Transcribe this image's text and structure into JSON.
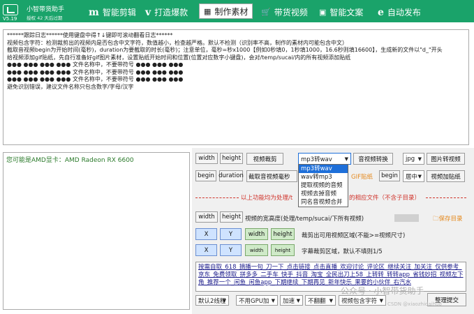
{
  "app": {
    "version": "V5.19",
    "name": "小智带货助手",
    "subtitle": "授权 42 天后过期",
    "brand_color": "#1aa36a"
  },
  "tabs": [
    {
      "icon": "m",
      "icon_name": "m-logo-icon",
      "label": "智能剪辑"
    },
    {
      "icon": "v",
      "icon_name": "v-logo-icon",
      "label": "打造爆款"
    },
    {
      "icon": "▦",
      "icon_name": "grid-icon",
      "label": "制作素材",
      "active": true
    },
    {
      "icon": "🛒",
      "icon_name": "cart-icon",
      "label": "带货视频"
    },
    {
      "icon": "▣",
      "icon_name": "document-icon",
      "label": "智能文案"
    },
    {
      "icon": "e",
      "icon_name": "e-logo-icon",
      "label": "自动发布"
    }
  ],
  "log_lines": [
    "******跟踪日志******使用键盘中得↑↓键即可滚动翻看日志******",
    "视频包含字符：检测裁剪出的视频内是否包含中文字符，数值越小，检查越严格。默认不检测（识别率不高，制作的素材内可能包含中文）",
    "截取音视频begin为开始时间(毫秒)，duration为要截取的时长(毫秒)；注意单位，毫秒=秒x1000【例如0秒填0，1秒填1000，16.6秒则填16600】，生成新的文件以\"d_\"开头",
    "给视频添加gif贴纸，先自行准备好gif图片素材，设置贴纸开始时间和位置(位置对应数字小键盘)，会对/temp/sucai/内的所有视频添加贴纸",
    "●●● ●●● ●●● ●●● 文件名称中，不要带符号 ●●● ●●● ●●●",
    "●●● ●●● ●●● ●●● 文件名称中，不要带符号 ●●● ●●● ●●●",
    "●●● ●●● ●●● ●●● 文件名称中，不要带符号 ●●● ●●● ●●●",
    "避免识别错误，建议文件名称只包含数字/字母/汉字"
  ],
  "gpu_text": "您可能是AMD显卡：AMD Radeon RX 6600",
  "row1": {
    "width_label": "width",
    "height_label": "height",
    "crop_button": "视频裁剪",
    "format_select": "mp3转wav",
    "convert_button": "音视频转换",
    "image_format_select": "jpg",
    "image_to_video_button": "图片转视频"
  },
  "dropdown_options": [
    "mp3转wav",
    "wav转mp3",
    "提取视频的音频",
    "视频去掉音频",
    "同名音视频合并"
  ],
  "row2": {
    "begin_label": "begin",
    "duration_label": "duration",
    "cut_button": "截取音视频毫秒",
    "gif_label": "GIF贴纸",
    "begin2_label": "begin",
    "position_select": "居中",
    "sticker_button": "视频加贴纸"
  },
  "notice": {
    "left": "以上功能均为处理/t",
    "right": "的相应文件（不含子目录）"
  },
  "row3": {
    "width_label": "width",
    "height_label": "height",
    "desc": "视频的宽高度(处理/temp/sucai/下所有视频)",
    "save_link": "保存目录"
  },
  "row4": {
    "x_label": "X",
    "y_label": "Y",
    "width_label": "width",
    "height_label": "height",
    "desc": "裁剪出可用视频区域(不能>=视频尺寸)"
  },
  "row5": {
    "x_label": "X",
    "y_label": "Y",
    "width_label": "width",
    "height_label": "height",
    "desc": "字幕裁剪区域，默认不填则1/5"
  },
  "keywords_text": "按需自取_618_摘播一句_刀一下_点击链接_点击直播_欢迎讨论_评论区_继续关注_加关注_仅供参考_京东_免费领取_拼多多_二手车_快手_抖音_淘宝_全民出刀上58_上转转_转转app_省钱妙招_视频左下角_推荐一个_闲鱼_闲鱼app_下期继续_下期再见_新年快乐_果要的小伙伴_右汽水",
  "bottom": {
    "threads_select": "默认2线程",
    "gpu_select": "不用GPU加",
    "speed_select": "加速",
    "flip_select": "不翻翻",
    "char_select": "视频包含字符",
    "submit_button": "整理提交"
  },
  "watermark": "公众号 · 小智带货助手",
  "csdn": "CSDN @xiaozhidaihuo"
}
